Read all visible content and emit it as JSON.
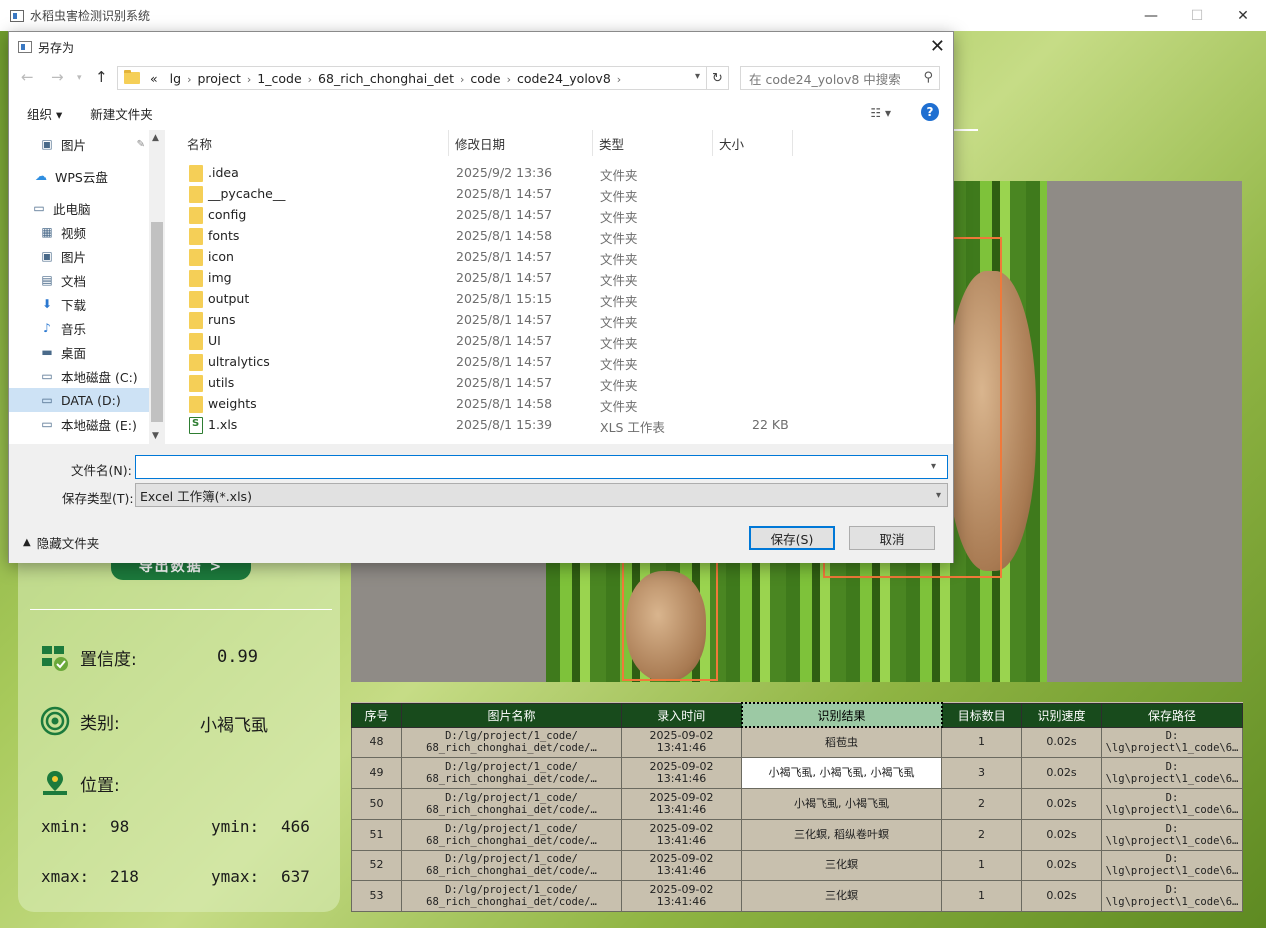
{
  "app": {
    "title": "水稻虫害检测识别系统",
    "window_controls": [
      "—",
      "☐",
      "✕"
    ]
  },
  "left_panel": {
    "export_button": "导出数据 >",
    "confidence_label": "置信度:",
    "confidence_value": "0.99",
    "category_label": "类别:",
    "category_value": "小褐飞虱",
    "position_label": "位置:",
    "xmin_label": "xmin:",
    "xmin_value": "98",
    "ymin_label": "ymin:",
    "ymin_value": "466",
    "xmax_label": "xmax:",
    "xmax_value": "218",
    "ymax_label": "ymax:",
    "ymax_value": "637"
  },
  "table": {
    "headers": [
      "序号",
      "图片名称",
      "录入时间",
      "识别结果",
      "目标数目",
      "识别速度",
      "保存路径"
    ],
    "rows": [
      {
        "id": "48",
        "name1": "D:/lg/project/1_code/",
        "name2": "68_rich_chonghai_det/code/…",
        "date": "2025-09-02",
        "time": "13:41:46",
        "result": "稻苞虫",
        "count": "1",
        "speed": "0.02s",
        "path1": "D:",
        "path2": "\\lg\\project\\1_code\\6…"
      },
      {
        "id": "49",
        "name1": "D:/lg/project/1_code/",
        "name2": "68_rich_chonghai_det/code/…",
        "date": "2025-09-02",
        "time": "13:41:46",
        "result": "小褐飞虱, 小褐飞虱, 小褐飞虱",
        "count": "3",
        "speed": "0.02s",
        "path1": "D:",
        "path2": "\\lg\\project\\1_code\\6…"
      },
      {
        "id": "50",
        "name1": "D:/lg/project/1_code/",
        "name2": "68_rich_chonghai_det/code/…",
        "date": "2025-09-02",
        "time": "13:41:46",
        "result": "小褐飞虱, 小褐飞虱",
        "count": "2",
        "speed": "0.02s",
        "path1": "D:",
        "path2": "\\lg\\project\\1_code\\6…"
      },
      {
        "id": "51",
        "name1": "D:/lg/project/1_code/",
        "name2": "68_rich_chonghai_det/code/…",
        "date": "2025-09-02",
        "time": "13:41:46",
        "result": "三化螟, 稻纵卷叶螟",
        "count": "2",
        "speed": "0.02s",
        "path1": "D:",
        "path2": "\\lg\\project\\1_code\\6…"
      },
      {
        "id": "52",
        "name1": "D:/lg/project/1_code/",
        "name2": "68_rich_chonghai_det/code/…",
        "date": "2025-09-02",
        "time": "13:41:46",
        "result": "三化螟",
        "count": "1",
        "speed": "0.02s",
        "path1": "D:",
        "path2": "\\lg\\project\\1_code\\6…"
      },
      {
        "id": "53",
        "name1": "D:/lg/project/1_code/",
        "name2": "68_rich_chonghai_det/code/…",
        "date": "2025-09-02",
        "time": "13:41:46",
        "result": "三化螟",
        "count": "1",
        "speed": "0.02s",
        "path1": "D:",
        "path2": "\\lg\\project\\1_code\\6…"
      }
    ]
  },
  "dialog": {
    "title": "另存为",
    "breadcrumbs": [
      "«",
      "lg",
      "project",
      "1_code",
      "68_rich_chonghai_det",
      "code",
      "code24_yolov8"
    ],
    "search_placeholder": "在 code24_yolov8 中搜索",
    "toolbar": {
      "organize": "组织 ▾",
      "new_folder": "新建文件夹"
    },
    "nav_items": [
      {
        "label": "图片",
        "icon": "pictures-icon",
        "glyph": "▣"
      },
      {
        "label": "WPS云盘",
        "icon": "cloud-icon",
        "glyph": "☁"
      },
      {
        "label": "此电脑",
        "icon": "computer-icon",
        "glyph": "▭"
      },
      {
        "label": "视频",
        "icon": "video-icon",
        "glyph": "▦"
      },
      {
        "label": "图片",
        "icon": "pictures-icon",
        "glyph": "▣"
      },
      {
        "label": "文档",
        "icon": "document-icon",
        "glyph": "▤"
      },
      {
        "label": "下载",
        "icon": "download-icon",
        "glyph": "⬇"
      },
      {
        "label": "音乐",
        "icon": "music-icon",
        "glyph": "♪"
      },
      {
        "label": "桌面",
        "icon": "desktop-icon",
        "glyph": "▬"
      },
      {
        "label": "本地磁盘 (C:)",
        "icon": "drive-icon",
        "glyph": "▭"
      },
      {
        "label": "DATA (D:)",
        "icon": "drive-icon",
        "glyph": "▭"
      },
      {
        "label": "本地磁盘 (E:)",
        "icon": "drive-icon",
        "glyph": "▭"
      }
    ],
    "columns": {
      "name": "名称",
      "date": "修改日期",
      "type": "类型",
      "size": "大小"
    },
    "files": [
      {
        "name": ".idea",
        "date": "2025/9/2 13:36",
        "type": "文件夹",
        "size": ""
      },
      {
        "name": "__pycache__",
        "date": "2025/8/1 14:57",
        "type": "文件夹",
        "size": ""
      },
      {
        "name": "config",
        "date": "2025/8/1 14:57",
        "type": "文件夹",
        "size": ""
      },
      {
        "name": "fonts",
        "date": "2025/8/1 14:58",
        "type": "文件夹",
        "size": ""
      },
      {
        "name": "icon",
        "date": "2025/8/1 14:57",
        "type": "文件夹",
        "size": ""
      },
      {
        "name": "img",
        "date": "2025/8/1 14:57",
        "type": "文件夹",
        "size": ""
      },
      {
        "name": "output",
        "date": "2025/8/1 15:15",
        "type": "文件夹",
        "size": ""
      },
      {
        "name": "runs",
        "date": "2025/8/1 14:57",
        "type": "文件夹",
        "size": ""
      },
      {
        "name": "UI",
        "date": "2025/8/1 14:57",
        "type": "文件夹",
        "size": ""
      },
      {
        "name": "ultralytics",
        "date": "2025/8/1 14:57",
        "type": "文件夹",
        "size": ""
      },
      {
        "name": "utils",
        "date": "2025/8/1 14:57",
        "type": "文件夹",
        "size": ""
      },
      {
        "name": "weights",
        "date": "2025/8/1 14:58",
        "type": "文件夹",
        "size": ""
      },
      {
        "name": "1.xls",
        "date": "2025/8/1 15:39",
        "type": "XLS 工作表",
        "size": "22 KB"
      }
    ],
    "filename_label": "文件名(N):",
    "filename_value": "",
    "filetype_label": "保存类型(T):",
    "filetype_value": "Excel 工作簿(*.xls)",
    "hide_folders": "隐藏文件夹",
    "save_button": "保存(S)",
    "cancel_button": "取消"
  },
  "colors": {
    "accent": "#0078d7",
    "table_header": "#184b1c",
    "export_button": "#1c7a3c",
    "bbox": "#f0793a"
  }
}
